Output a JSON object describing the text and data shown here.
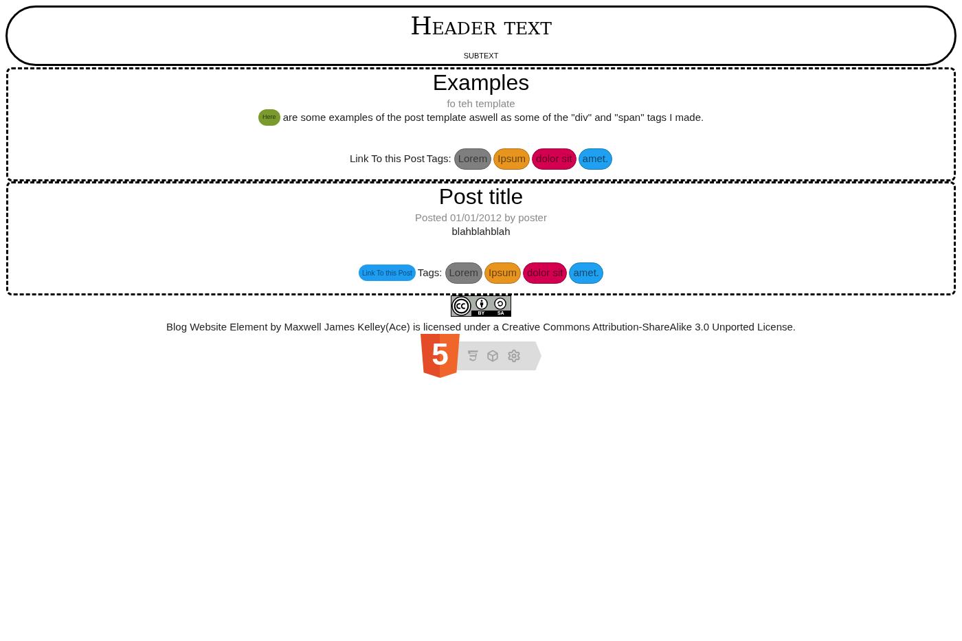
{
  "header": {
    "title": "Header text",
    "subtitle": "subtext"
  },
  "posts": [
    {
      "title": "Examples",
      "meta": "fo teh template",
      "body": {
        "link": "Here",
        "text": "are some examples of the post template aswell as some of the \"div\" and \"span\" tags I made."
      },
      "permalink": {
        "kind": "plain",
        "label": "Link To this Post"
      },
      "tags_label": "Tags:",
      "tags": [
        {
          "label": "Lorem",
          "color": "#7f7f7f"
        },
        {
          "label": "Ipsum",
          "color": "#e8951f"
        },
        {
          "label": "dolor sit",
          "color": "#d3004f"
        },
        {
          "label": "amet.",
          "color": "#1fa0f0"
        }
      ]
    },
    {
      "title": "Post title",
      "meta": "Posted 01/01/2012 by poster",
      "body": {
        "text": "blahblahblah"
      },
      "permalink": {
        "kind": "pill",
        "label": "Link To this Post"
      },
      "tags_label": "Tags:",
      "tags": [
        {
          "label": "Lorem",
          "color": "#7f7f7f"
        },
        {
          "label": "Ipsum",
          "color": "#e8951f"
        },
        {
          "label": "dolor sit",
          "color": "#d3004f"
        },
        {
          "label": "amet.",
          "color": "#1fa0f0"
        }
      ]
    }
  ],
  "footer": {
    "license_badge": {
      "labels": [
        "BY",
        "SA"
      ]
    },
    "license_text": "Blog Website Element by Maxwell James Kelley(Ace) is licensed under a Creative Commons Attribution-ShareAlike 3.0 Unported License.",
    "shield_logo": "5"
  }
}
